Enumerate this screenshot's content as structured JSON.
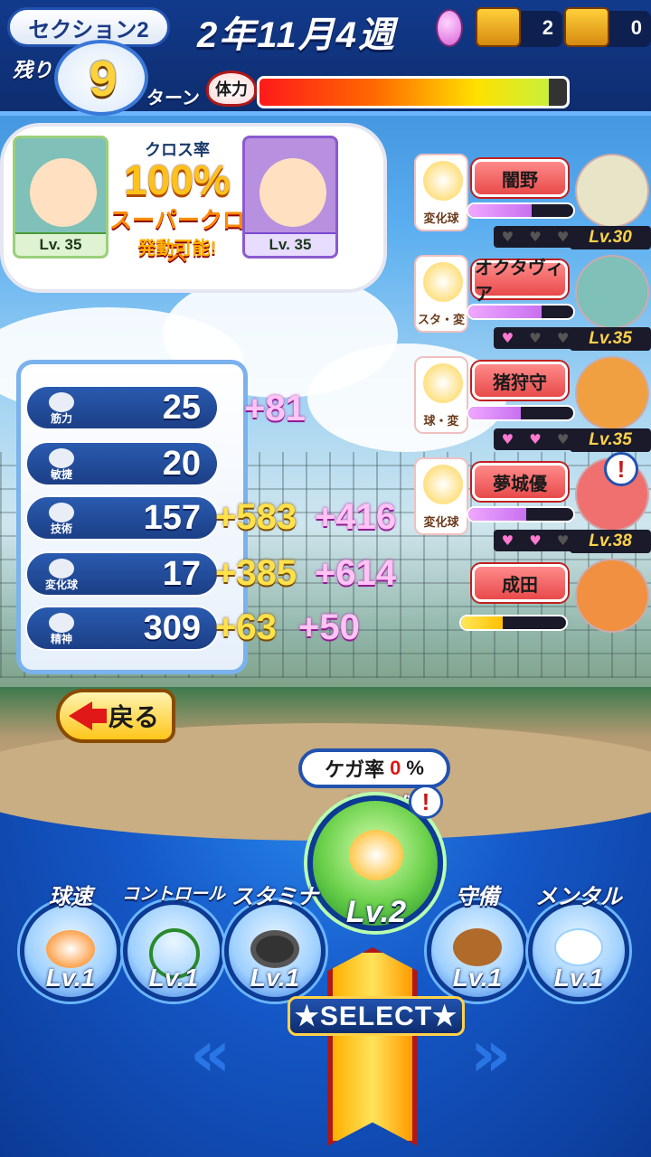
{
  "header": {
    "section": "セクション2",
    "remaining_label": "残り",
    "turns_left": "9",
    "turn_label": "ターン",
    "date": "2年11月4週",
    "chest_red_count": "2",
    "chest_gold_count": "0",
    "stamina_label": "体力",
    "stamina_fraction": 0.94
  },
  "cross": {
    "rate_label": "クロス率",
    "rate": "100%",
    "super_cross": "スーパークロス",
    "activatable": "発動可能!",
    "left_level": "Lv. 35",
    "right_level": "Lv. 35"
  },
  "partners": [
    {
      "name": "闇野",
      "tag": "変化球",
      "hearts": [
        false,
        false,
        false
      ],
      "level": "Lv.30",
      "bar": 0.6
    },
    {
      "name": "オクタヴィア",
      "tag": "スタ・変",
      "hearts": [
        true,
        false,
        false
      ],
      "level": "Lv.35",
      "bar": 0.7
    },
    {
      "name": "猪狩守",
      "tag": "球・変",
      "hearts": [
        true,
        true,
        false
      ],
      "level": "Lv.35",
      "bar": 0.5
    },
    {
      "name": "夢城優",
      "tag": "変化球",
      "hearts": [
        true,
        true,
        false
      ],
      "level": "Lv.38",
      "bar": 0.55
    },
    {
      "name": "成田",
      "tag": "",
      "hearts": [],
      "level": "",
      "bar": 0.4
    }
  ],
  "stats": [
    {
      "icon": "筋力",
      "value": "25",
      "gain1": "",
      "gain2": "+81"
    },
    {
      "icon": "敏捷",
      "value": "20",
      "gain1": "",
      "gain2": ""
    },
    {
      "icon": "技術",
      "value": "157",
      "gain1": "+583",
      "gain2": "+416"
    },
    {
      "icon": "変化球",
      "value": "17",
      "gain1": "+385",
      "gain2": "+614"
    },
    {
      "icon": "精神",
      "value": "309",
      "gain1": "+63",
      "gain2": "+50"
    }
  ],
  "back_label": "戻る",
  "injury": {
    "label": "ケガ率",
    "value": "0",
    "unit": "%"
  },
  "selected_practice": {
    "name": "変化球",
    "level": "Lv.2"
  },
  "practices": [
    {
      "name": "球速",
      "level": "Lv.1"
    },
    {
      "name": "コントロール",
      "level": "Lv.1"
    },
    {
      "name": "スタミナ",
      "level": "Lv.1"
    },
    {
      "name": "守備",
      "level": "Lv.1"
    },
    {
      "name": "メンタル",
      "level": "Lv.1"
    }
  ],
  "select_label": "★SELECT★",
  "alert_mark": "!",
  "icons": {
    "egg": "pink-egg-icon",
    "chest_red": "treasure-chest-icon",
    "chest_gold": "gold-chest-icon",
    "stamina_heart": "heart-icon",
    "back_arrow": "left-arrow-icon"
  },
  "colors": {
    "accent": "#ffd24a",
    "primary": "#1c3f86",
    "danger": "#e01818"
  }
}
